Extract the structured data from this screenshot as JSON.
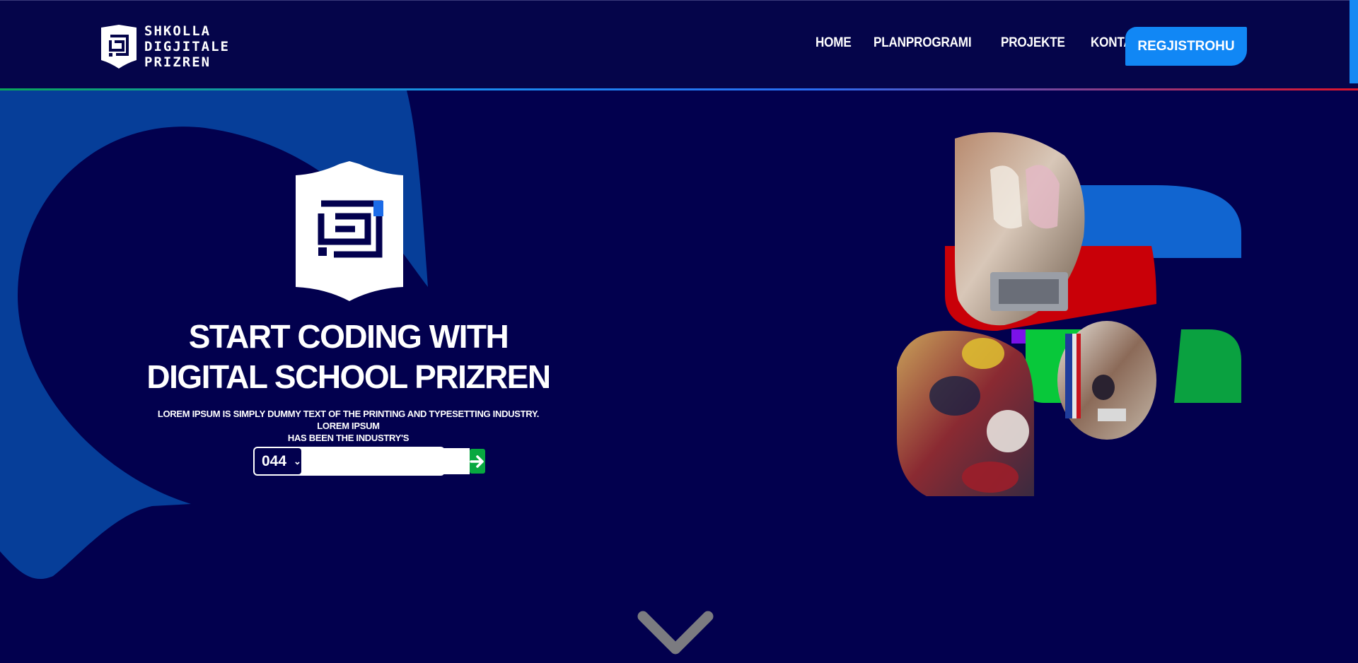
{
  "header": {
    "logo_lines": [
      "SHKOLLA",
      "DIGJITALE",
      "PRIZREN"
    ],
    "nav": [
      "HOME",
      "PLANPROGRAMI",
      "PROJEKTE",
      "KONTAKTI"
    ],
    "register_label": "REGJISTROHU"
  },
  "hero": {
    "title_line1": "START CODING WITH",
    "title_line2": "DIGITAL SCHOOL PRIZREN",
    "subtitle_line1": "LOREM IPSUM IS SIMPLY DUMMY TEXT OF THE PRINTING AND TYPESETTING INDUSTRY. LOREM IPSUM",
    "subtitle_line2": "HAS BEEN THE INDUSTRY'S",
    "phone_prefix": "044",
    "phone_value": ""
  },
  "colors": {
    "background": "#02004e",
    "accent_blue": "#1187f5",
    "accent_green": "#08a840",
    "accent_red": "#cc0000",
    "accent_purple": "#7b12e8"
  },
  "icons": {
    "logo": "shield-logo-icon",
    "submit": "arrow-right-icon",
    "prefix_toggle": "chevron-down-icon",
    "scroll": "chevron-down-icon"
  }
}
